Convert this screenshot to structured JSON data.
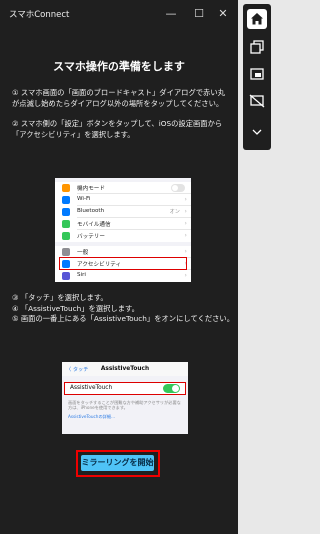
{
  "window": {
    "title": "スマホConnect",
    "controls": {
      "minimize": "—",
      "maximize": "☐",
      "close": "✕"
    }
  },
  "content": {
    "heading": "スマホ操作の準備をします",
    "step1": "① スマホ画面の「画面のブロードキャスト」ダイアログで赤い丸が点滅し始めたらダイアログ以外の場所をタップしてください。",
    "step2": "② スマホ側の「設定」ボタンをタップして、iOSの設定画面から「アクセシビリティ」を選択します。",
    "step3": "③ 「タッチ」を選択します。",
    "step4": "④ 「AssistiveTouch」を選択します。",
    "step5": "⑤ 画面の一番上にある「AssistiveTouch」をオンにしてください。",
    "start_button": "ミラーリングを開始"
  },
  "settings_screenshot": {
    "rows": [
      {
        "label": "機内モード",
        "value": "",
        "icon_color": "#ff9500"
      },
      {
        "label": "Wi-Fi",
        "value": "",
        "icon_color": "#007aff"
      },
      {
        "label": "Bluetooth",
        "value": "オン",
        "icon_color": "#007aff"
      },
      {
        "label": "モバイル通信",
        "value": "",
        "icon_color": "#34c759"
      },
      {
        "label": "バッテリー",
        "value": "",
        "icon_color": "#34c759"
      },
      {
        "label": "一般",
        "value": "",
        "icon_color": "#8e8e93"
      },
      {
        "label": "アクセシビリティ",
        "value": "",
        "icon_color": "#007aff"
      },
      {
        "label": "Siri",
        "value": "",
        "icon_color": "#5856d6"
      }
    ]
  },
  "assistive_screenshot": {
    "back_label": "〈 タッチ",
    "title": "AssistiveTouch",
    "toggle_label": "AssistiveTouch",
    "toggle_on": true,
    "description": "画面をタッチすることが困難な方や補助アクセサリが必要な方は、iPhoneを使用できます。",
    "link": "AssistiveTouchの詳細..."
  },
  "sidebar": {
    "icons": [
      "home-icon",
      "copy-icon",
      "window-icon",
      "screen-off-icon",
      "chevron-down-icon"
    ]
  }
}
